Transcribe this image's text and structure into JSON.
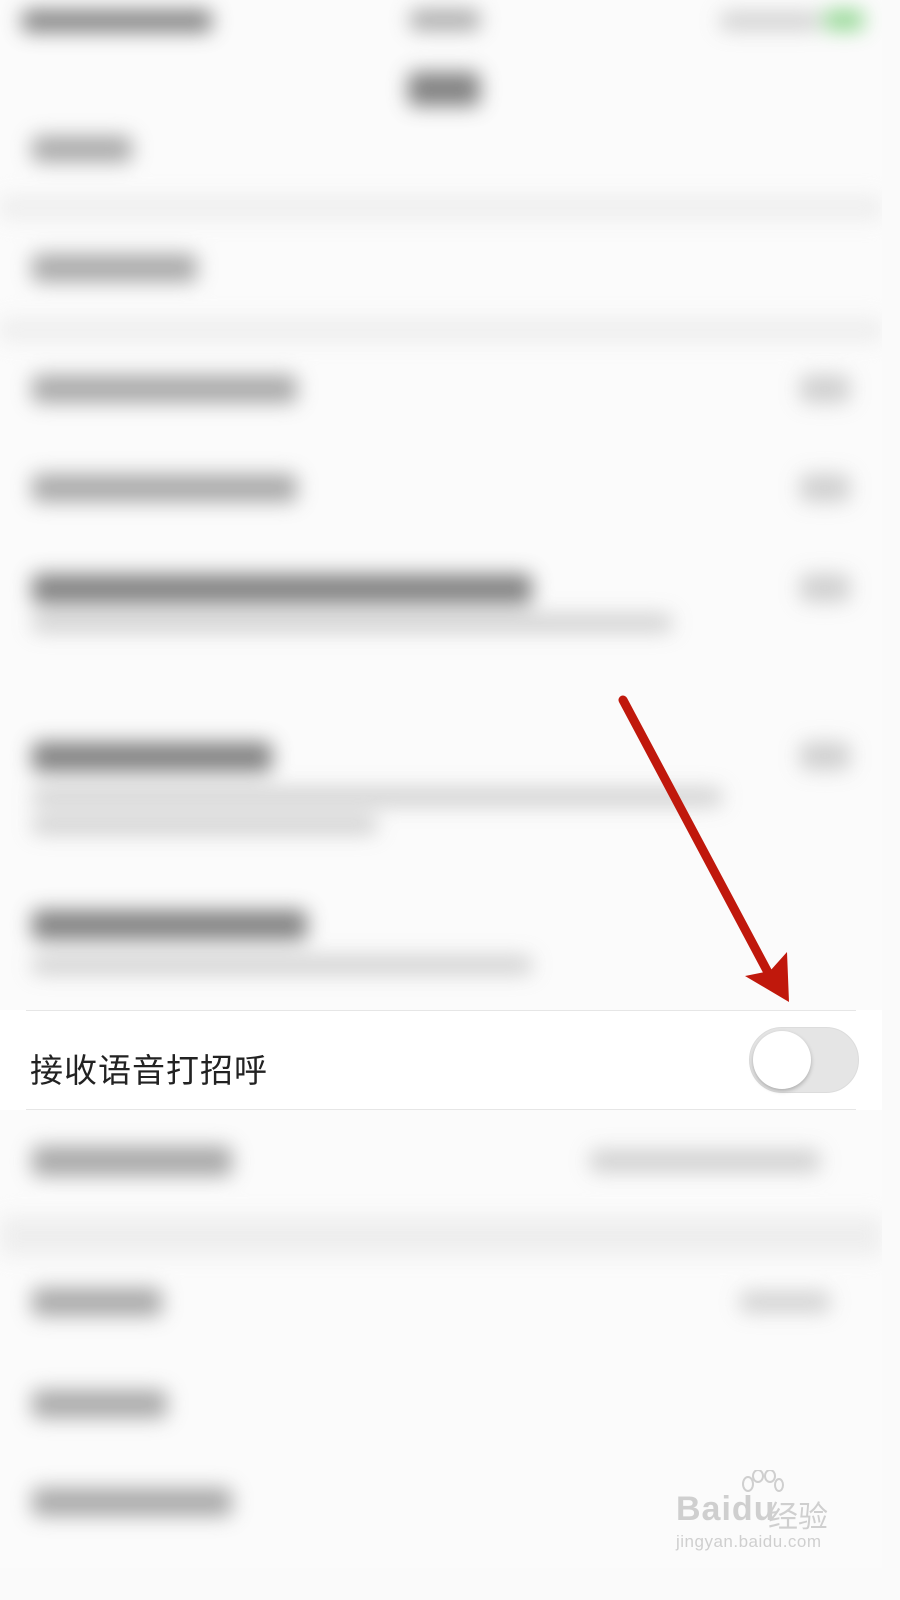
{
  "setting": {
    "label": "接收语音打招呼",
    "toggle_on": false
  },
  "watermark": {
    "brand": "Bai",
    "brand_tail": "du",
    "brand_cn": "经验",
    "domain": "jingyan.baidu.com"
  },
  "colors": {
    "arrow": "#c0180c",
    "toggle_off": "#e5e5e5"
  }
}
